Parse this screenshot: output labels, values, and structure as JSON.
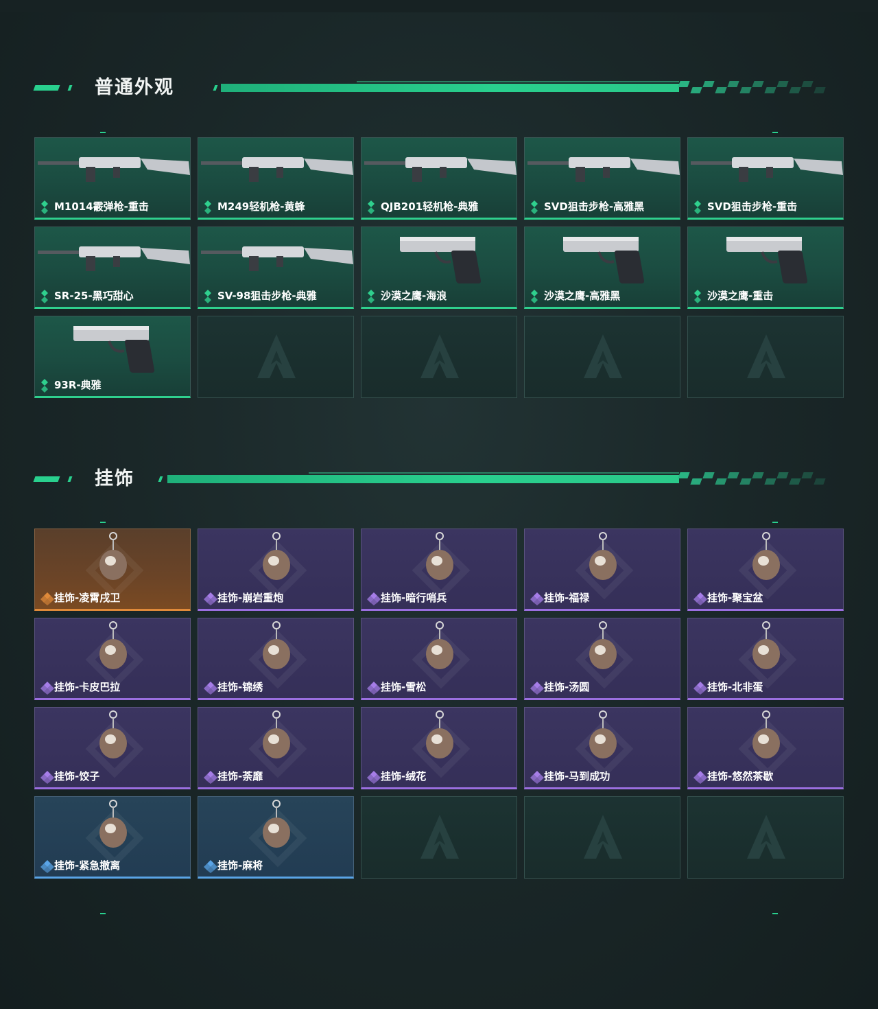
{
  "sections": [
    {
      "title": "普通外观",
      "items": [
        {
          "label": "M1014霰弹枪-重击",
          "kind": "skin",
          "icon": "shotgun-icon"
        },
        {
          "label": "M249轻机枪-黄蜂",
          "kind": "skin",
          "icon": "machine-gun-icon"
        },
        {
          "label": "QJB201轻机枪-典雅",
          "kind": "skin",
          "icon": "machine-gun-icon"
        },
        {
          "label": "SVD狙击步枪-高雅黑",
          "kind": "skin",
          "icon": "sniper-rifle-icon"
        },
        {
          "label": "SVD狙击步枪-重击",
          "kind": "skin",
          "icon": "sniper-rifle-icon"
        },
        {
          "label": "SR-25-黑巧甜心",
          "kind": "skin",
          "icon": "rifle-icon"
        },
        {
          "label": "SV-98狙击步枪-典雅",
          "kind": "skin",
          "icon": "sniper-rifle-icon"
        },
        {
          "label": "沙漠之鹰-海浪",
          "kind": "skin",
          "icon": "pistol-icon"
        },
        {
          "label": "沙漠之鹰-高雅黑",
          "kind": "skin",
          "icon": "pistol-icon"
        },
        {
          "label": "沙漠之鹰-重击",
          "kind": "skin",
          "icon": "pistol-icon"
        },
        {
          "label": "93R-典雅",
          "kind": "skin",
          "icon": "pistol-icon"
        }
      ]
    },
    {
      "title": "挂饰",
      "items": [
        {
          "label": "挂饰-凌霄戌卫",
          "kind": "orange",
          "icon": "charm-icon"
        },
        {
          "label": "挂饰-崩岩重炮",
          "kind": "purple",
          "icon": "charm-icon"
        },
        {
          "label": "挂饰-暗行哨兵",
          "kind": "purple",
          "icon": "charm-icon"
        },
        {
          "label": "挂饰-福禄",
          "kind": "purple",
          "icon": "charm-icon"
        },
        {
          "label": "挂饰-聚宝盆",
          "kind": "purple",
          "icon": "charm-icon"
        },
        {
          "label": "挂饰-卡皮巴拉",
          "kind": "purple",
          "icon": "charm-icon"
        },
        {
          "label": "挂饰-锦绣",
          "kind": "purple",
          "icon": "charm-icon"
        },
        {
          "label": "挂饰-雪松",
          "kind": "purple",
          "icon": "charm-icon"
        },
        {
          "label": "挂饰-汤圆",
          "kind": "purple",
          "icon": "charm-icon"
        },
        {
          "label": "挂饰-北非蛋",
          "kind": "purple",
          "icon": "charm-icon"
        },
        {
          "label": "挂饰-饺子",
          "kind": "purple",
          "icon": "charm-icon"
        },
        {
          "label": "挂饰-荼靡",
          "kind": "purple",
          "icon": "charm-icon"
        },
        {
          "label": "挂饰-绒花",
          "kind": "purple",
          "icon": "charm-icon"
        },
        {
          "label": "挂饰-马到成功",
          "kind": "purple",
          "icon": "charm-icon"
        },
        {
          "label": "挂饰-悠然茶歇",
          "kind": "purple",
          "icon": "charm-icon"
        },
        {
          "label": "挂饰-紧急撤离",
          "kind": "blue",
          "icon": "charm-icon"
        },
        {
          "label": "挂饰-麻将",
          "kind": "blue",
          "icon": "charm-icon"
        }
      ]
    }
  ],
  "colors": {
    "accent": "#29d08e",
    "rarity_green": "#2fd08e",
    "rarity_purple": "#9b6fe0",
    "rarity_orange": "#e08a3a",
    "rarity_blue": "#5aa4e6"
  }
}
